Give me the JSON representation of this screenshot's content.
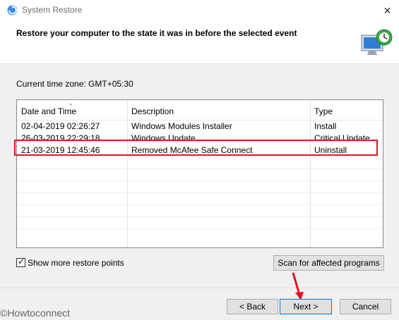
{
  "window": {
    "title": "System Restore",
    "close_label": "✕"
  },
  "header": {
    "title": "Restore your computer to the state it was in before the selected event"
  },
  "timezone": "Current time zone: GMT+05:30",
  "table": {
    "columns": [
      "Date and Time",
      "Description",
      "Type"
    ],
    "rows": [
      {
        "date": "02-04-2019 02:26:27",
        "description": "Windows Modules Installer",
        "type": "Install"
      },
      {
        "date": "26-03-2019 22:29:18",
        "description": "Windows Update",
        "type": "Critical Update"
      },
      {
        "date": "21-03-2019 12:45:46",
        "description": "Removed McAfee Safe Connect",
        "type": "Uninstall"
      }
    ]
  },
  "options": {
    "show_more_label": "Show more restore points",
    "show_more_checked": true
  },
  "buttons": {
    "scan": "Scan for affected programs",
    "back": "< Back",
    "next": "Next >",
    "cancel": "Cancel"
  },
  "watermark": "©Howtoconnect",
  "colors": {
    "highlight": "#e0141e",
    "accent": "#0078d7"
  }
}
